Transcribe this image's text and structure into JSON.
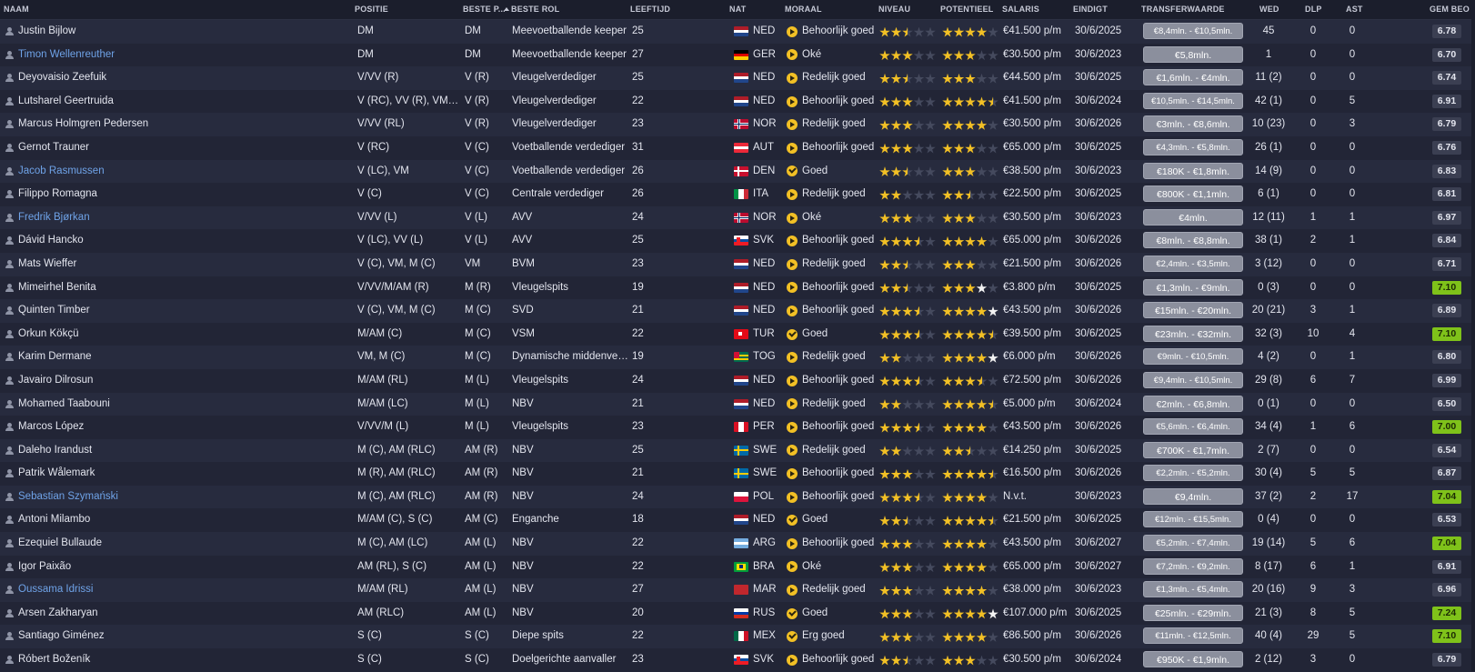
{
  "headers": {
    "naam": "NAAM",
    "positie": "POSITIE",
    "beste_p": "BESTE P...",
    "beste_rol": "BESTE ROL",
    "leeftijd": "LEEFTIJD",
    "nat": "NAT",
    "moraal": "MORAAL",
    "niveau": "NIVEAU",
    "potentieel": "POTENTIEEL",
    "salaris": "SALARIS",
    "eindigt": "EINDIGT",
    "transferwaarde": "TRANSFERWAARDE",
    "wed": "WED",
    "dlp": "DLP",
    "ast": "AST",
    "gem_beo": "GEM BEO"
  },
  "colors": {
    "link": "#6fa3e8",
    "star": "#f2c025",
    "rating_good": "#7fc21a"
  },
  "players": [
    {
      "name": "Justin Bijlow",
      "link": false,
      "pos": "DM",
      "bp": "DM",
      "rol": "Meevoetballende keeper",
      "age": "25",
      "nat": "NED",
      "flag": "ned",
      "moral": "Behoorlijk goed",
      "mi": "arrow",
      "niv": "ffhee",
      "pot": "ffffe",
      "sal": "€41.500 p/m",
      "end": "30/6/2025",
      "tv": "€8,4mln. - €10,5mln.",
      "wed": "45",
      "dlp": "0",
      "ast": "0",
      "gb": "6.78"
    },
    {
      "name": "Timon Wellenreuther",
      "link": true,
      "pos": "DM",
      "bp": "DM",
      "rol": "Meevoetballende keeper",
      "age": "27",
      "nat": "GER",
      "flag": "ger",
      "moral": "Oké",
      "mi": "arrow",
      "niv": "fffee",
      "pot": "fffee",
      "sal": "€30.500 p/m",
      "end": "30/6/2023",
      "tv": "€5,8mln.",
      "wed": "1",
      "dlp": "0",
      "ast": "0",
      "gb": "6.70"
    },
    {
      "name": "Deyovaisio Zeefuik",
      "link": false,
      "pos": "V/VV (R)",
      "bp": "V (R)",
      "rol": "Vleugelverdediger",
      "age": "25",
      "nat": "NED",
      "flag": "ned",
      "moral": "Redelijk goed",
      "mi": "arrow",
      "niv": "ffhee",
      "pot": "fffee",
      "sal": "€44.500 p/m",
      "end": "30/6/2025",
      "tv": "€1,6mln. - €4mln.",
      "wed": "11 (2)",
      "dlp": "0",
      "ast": "0",
      "gb": "6.74"
    },
    {
      "name": "Lutsharel Geertruida",
      "link": false,
      "pos": "V (RC), VV (R), VM, M...",
      "bp": "V (R)",
      "rol": "Vleugelverdediger",
      "age": "22",
      "nat": "NED",
      "flag": "ned",
      "moral": "Behoorlijk goed",
      "mi": "arrow",
      "niv": "fffee",
      "pot": "ffffh",
      "sal": "€41.500 p/m",
      "end": "30/6/2024",
      "tv": "€10,5mln. - €14,5mln.",
      "wed": "42 (1)",
      "dlp": "0",
      "ast": "5",
      "gb": "6.91"
    },
    {
      "name": "Marcus Holmgren Pedersen",
      "link": false,
      "pos": "V/VV (RL)",
      "bp": "V (R)",
      "rol": "Vleugelverdediger",
      "age": "23",
      "nat": "NOR",
      "flag": "nor",
      "moral": "Redelijk goed",
      "mi": "arrow",
      "niv": "fffee",
      "pot": "ffffe",
      "sal": "€30.500 p/m",
      "end": "30/6/2026",
      "tv": "€3mln. - €8,6mln.",
      "wed": "10 (23)",
      "dlp": "0",
      "ast": "3",
      "gb": "6.79"
    },
    {
      "name": "Gernot Trauner",
      "link": false,
      "pos": "V (RC)",
      "bp": "V (C)",
      "rol": "Voetballende verdediger",
      "age": "31",
      "nat": "AUT",
      "flag": "aut",
      "moral": "Behoorlijk goed",
      "mi": "arrow",
      "niv": "fffee",
      "pot": "fffee",
      "sal": "€65.000 p/m",
      "end": "30/6/2025",
      "tv": "€4,3mln. - €5,8mln.",
      "wed": "26 (1)",
      "dlp": "0",
      "ast": "0",
      "gb": "6.76"
    },
    {
      "name": "Jacob Rasmussen",
      "link": true,
      "pos": "V (LC), VM",
      "bp": "V (C)",
      "rol": "Voetballende verdediger",
      "age": "26",
      "nat": "DEN",
      "flag": "den",
      "moral": "Goed",
      "mi": "check",
      "niv": "ffhee",
      "pot": "fffee",
      "sal": "€38.500 p/m",
      "end": "30/6/2023",
      "tv": "€180K - €1,8mln.",
      "wed": "14 (9)",
      "dlp": "0",
      "ast": "0",
      "gb": "6.83"
    },
    {
      "name": "Filippo Romagna",
      "link": false,
      "pos": "V (C)",
      "bp": "V (C)",
      "rol": "Centrale verdediger",
      "age": "26",
      "nat": "ITA",
      "flag": "ita",
      "moral": "Redelijk goed",
      "mi": "arrow",
      "niv": "ffeee",
      "pot": "ffhee",
      "sal": "€22.500 p/m",
      "end": "30/6/2025",
      "tv": "€800K - €1,1mln.",
      "wed": "6 (1)",
      "dlp": "0",
      "ast": "0",
      "gb": "6.81"
    },
    {
      "name": "Fredrik Bjørkan",
      "link": true,
      "pos": "V/VV (L)",
      "bp": "V (L)",
      "rol": "AVV",
      "age": "24",
      "nat": "NOR",
      "flag": "nor",
      "moral": "Oké",
      "mi": "arrow",
      "niv": "fffee",
      "pot": "fffee",
      "sal": "€30.500 p/m",
      "end": "30/6/2023",
      "tv": "€4mln.",
      "wed": "12 (11)",
      "dlp": "1",
      "ast": "1",
      "gb": "6.97"
    },
    {
      "name": "Dávid Hancko",
      "link": false,
      "pos": "V (LC), VV (L)",
      "bp": "V (L)",
      "rol": "AVV",
      "age": "25",
      "nat": "SVK",
      "flag": "svk",
      "moral": "Behoorlijk goed",
      "mi": "arrow",
      "niv": "fffhe",
      "pot": "ffffe",
      "sal": "€65.000 p/m",
      "end": "30/6/2026",
      "tv": "€8mln. - €8,8mln.",
      "wed": "38 (1)",
      "dlp": "2",
      "ast": "1",
      "gb": "6.84"
    },
    {
      "name": "Mats Wieffer",
      "link": false,
      "pos": "V (C), VM, M (C)",
      "bp": "VM",
      "rol": "BVM",
      "age": "23",
      "nat": "NED",
      "flag": "ned",
      "moral": "Redelijk goed",
      "mi": "arrow",
      "niv": "ffhee",
      "pot": "fffee",
      "sal": "€21.500 p/m",
      "end": "30/6/2026",
      "tv": "€2,4mln. - €3,5mln.",
      "wed": "3 (12)",
      "dlp": "0",
      "ast": "0",
      "gb": "6.71"
    },
    {
      "name": "Mimeirhel Benita",
      "link": false,
      "pos": "V/VV/M/AM (R)",
      "bp": "M (R)",
      "rol": "Vleugelspits",
      "age": "19",
      "nat": "NED",
      "flag": "ned",
      "moral": "Behoorlijk goed",
      "mi": "arrow",
      "niv": "ffhee",
      "pot": "fffwe",
      "sal": "€3.800 p/m",
      "end": "30/6/2025",
      "tv": "€1,3mln. - €9mln.",
      "wed": "0 (3)",
      "dlp": "0",
      "ast": "0",
      "gb": "7.10"
    },
    {
      "name": "Quinten Timber",
      "link": false,
      "pos": "V (C), VM, M (C)",
      "bp": "M (C)",
      "rol": "SVD",
      "age": "21",
      "nat": "NED",
      "flag": "ned",
      "moral": "Behoorlijk goed",
      "mi": "arrow",
      "niv": "fffhe",
      "pot": "ffffw",
      "sal": "€43.500 p/m",
      "end": "30/6/2026",
      "tv": "€15mln. - €20mln.",
      "wed": "20 (21)",
      "dlp": "3",
      "ast": "1",
      "gb": "6.89"
    },
    {
      "name": "Orkun Kökçü",
      "link": false,
      "pos": "M/AM (C)",
      "bp": "M (C)",
      "rol": "VSM",
      "age": "22",
      "nat": "TUR",
      "flag": "tur",
      "moral": "Goed",
      "mi": "check",
      "niv": "fffhe",
      "pot": "ffffh",
      "sal": "€39.500 p/m",
      "end": "30/6/2025",
      "tv": "€23mln. - €32mln.",
      "wed": "32 (3)",
      "dlp": "10",
      "ast": "4",
      "gb": "7.10"
    },
    {
      "name": "Karim Dermane",
      "link": false,
      "pos": "VM, M (C)",
      "bp": "M (C)",
      "rol": "Dynamische middenvelder",
      "age": "19",
      "nat": "TOG",
      "flag": "tog",
      "moral": "Redelijk goed",
      "mi": "arrow",
      "niv": "ffeee",
      "pot": "ffffw",
      "sal": "€6.000 p/m",
      "end": "30/6/2026",
      "tv": "€9mln. - €10,5mln.",
      "wed": "4 (2)",
      "dlp": "0",
      "ast": "1",
      "gb": "6.80"
    },
    {
      "name": "Javairo Dilrosun",
      "link": false,
      "pos": "M/AM (RL)",
      "bp": "M (L)",
      "rol": "Vleugelspits",
      "age": "24",
      "nat": "NED",
      "flag": "ned",
      "moral": "Behoorlijk goed",
      "mi": "arrow",
      "niv": "fffhe",
      "pot": "fffhe",
      "sal": "€72.500 p/m",
      "end": "30/6/2026",
      "tv": "€9,4mln. - €10,5mln.",
      "wed": "29 (8)",
      "dlp": "6",
      "ast": "7",
      "gb": "6.99"
    },
    {
      "name": "Mohamed Taabouni",
      "link": false,
      "pos": "M/AM (LC)",
      "bp": "M (L)",
      "rol": "NBV",
      "age": "21",
      "nat": "NED",
      "flag": "ned",
      "moral": "Redelijk goed",
      "mi": "arrow",
      "niv": "ffeee",
      "pot": "ffffh",
      "sal": "€5.000 p/m",
      "end": "30/6/2024",
      "tv": "€2mln. - €6,8mln.",
      "wed": "0 (1)",
      "dlp": "0",
      "ast": "0",
      "gb": "6.50"
    },
    {
      "name": "Marcos López",
      "link": false,
      "pos": "V/VV/M (L)",
      "bp": "M (L)",
      "rol": "Vleugelspits",
      "age": "23",
      "nat": "PER",
      "flag": "per",
      "moral": "Behoorlijk goed",
      "mi": "arrow",
      "niv": "fffhe",
      "pot": "ffffe",
      "sal": "€43.500 p/m",
      "end": "30/6/2026",
      "tv": "€5,6mln. - €6,4mln.",
      "wed": "34 (4)",
      "dlp": "1",
      "ast": "6",
      "gb": "7.00"
    },
    {
      "name": "Daleho Irandust",
      "link": false,
      "pos": "M (C), AM (RLC)",
      "bp": "AM (R)",
      "rol": "NBV",
      "age": "25",
      "nat": "SWE",
      "flag": "swe",
      "moral": "Redelijk goed",
      "mi": "arrow",
      "niv": "ffeee",
      "pot": "ffhee",
      "sal": "€14.250 p/m",
      "end": "30/6/2025",
      "tv": "€700K - €1,7mln.",
      "wed": "2 (7)",
      "dlp": "0",
      "ast": "0",
      "gb": "6.54"
    },
    {
      "name": "Patrik Wålemark",
      "link": false,
      "pos": "M (R), AM (RLC)",
      "bp": "AM (R)",
      "rol": "NBV",
      "age": "21",
      "nat": "SWE",
      "flag": "swe",
      "moral": "Behoorlijk goed",
      "mi": "arrow",
      "niv": "fffee",
      "pot": "ffffh",
      "sal": "€16.500 p/m",
      "end": "30/6/2026",
      "tv": "€2,2mln. - €5,2mln.",
      "wed": "30 (4)",
      "dlp": "5",
      "ast": "5",
      "gb": "6.87"
    },
    {
      "name": "Sebastian Szymański",
      "link": true,
      "pos": "M (C), AM (RLC)",
      "bp": "AM (R)",
      "rol": "NBV",
      "age": "24",
      "nat": "POL",
      "flag": "pol",
      "moral": "Behoorlijk goed",
      "mi": "arrow",
      "niv": "fffhe",
      "pot": "ffffe",
      "sal": "N.v.t.",
      "end": "30/6/2023",
      "tv": "€9,4mln.",
      "wed": "37 (2)",
      "dlp": "2",
      "ast": "17",
      "gb": "7.04"
    },
    {
      "name": "Antoni Milambo",
      "link": false,
      "pos": "M/AM (C), S (C)",
      "bp": "AM (C)",
      "rol": "Enganche",
      "age": "18",
      "nat": "NED",
      "flag": "ned",
      "moral": "Goed",
      "mi": "check",
      "niv": "ffhee",
      "pot": "ffffh",
      "sal": "€21.500 p/m",
      "end": "30/6/2025",
      "tv": "€12mln. - €15,5mln.",
      "wed": "0 (4)",
      "dlp": "0",
      "ast": "0",
      "gb": "6.53"
    },
    {
      "name": "Ezequiel Bullaude",
      "link": false,
      "pos": "M (C), AM (LC)",
      "bp": "AM (L)",
      "rol": "NBV",
      "age": "22",
      "nat": "ARG",
      "flag": "arg",
      "moral": "Behoorlijk goed",
      "mi": "arrow",
      "niv": "fffee",
      "pot": "ffffe",
      "sal": "€43.500 p/m",
      "end": "30/6/2027",
      "tv": "€5,2mln. - €7,4mln.",
      "wed": "19 (14)",
      "dlp": "5",
      "ast": "6",
      "gb": "7.04"
    },
    {
      "name": "Igor Paixão",
      "link": false,
      "pos": "AM (RL), S (C)",
      "bp": "AM (L)",
      "rol": "NBV",
      "age": "22",
      "nat": "BRA",
      "flag": "bra",
      "moral": "Oké",
      "mi": "arrow",
      "niv": "fffee",
      "pot": "ffffe",
      "sal": "€65.000 p/m",
      "end": "30/6/2027",
      "tv": "€7,2mln. - €9,2mln.",
      "wed": "8 (17)",
      "dlp": "6",
      "ast": "1",
      "gb": "6.91"
    },
    {
      "name": "Oussama Idrissi",
      "link": true,
      "pos": "M/AM (RL)",
      "bp": "AM (L)",
      "rol": "NBV",
      "age": "27",
      "nat": "MAR",
      "flag": "mar",
      "moral": "Redelijk goed",
      "mi": "arrow",
      "niv": "fffee",
      "pot": "ffffe",
      "sal": "€38.000 p/m",
      "end": "30/6/2023",
      "tv": "€1,3mln. - €5,4mln.",
      "wed": "20 (16)",
      "dlp": "9",
      "ast": "3",
      "gb": "6.96"
    },
    {
      "name": "Arsen Zakharyan",
      "link": false,
      "pos": "AM (RLC)",
      "bp": "AM (L)",
      "rol": "NBV",
      "age": "20",
      "nat": "RUS",
      "flag": "rus",
      "moral": "Goed",
      "mi": "check",
      "niv": "fffee",
      "pot": "ffffw",
      "sal": "€107.000 p/m",
      "end": "30/6/2025",
      "tv": "€25mln. - €29mln.",
      "wed": "21 (3)",
      "dlp": "8",
      "ast": "5",
      "gb": "7.24"
    },
    {
      "name": "Santiago Giménez",
      "link": false,
      "pos": "S (C)",
      "bp": "S (C)",
      "rol": "Diepe spits",
      "age": "22",
      "nat": "MEX",
      "flag": "mex",
      "moral": "Erg goed",
      "mi": "check",
      "niv": "fffee",
      "pot": "ffffe",
      "sal": "€86.500 p/m",
      "end": "30/6/2026",
      "tv": "€11mln. - €12,5mln.",
      "wed": "40 (4)",
      "dlp": "29",
      "ast": "5",
      "gb": "7.10"
    },
    {
      "name": "Róbert Boženík",
      "link": false,
      "pos": "S (C)",
      "bp": "S (C)",
      "rol": "Doelgerichte aanvaller",
      "age": "23",
      "nat": "SVK",
      "flag": "svk",
      "moral": "Behoorlijk goed",
      "mi": "arrow",
      "niv": "ffhee",
      "pot": "fffee",
      "sal": "€30.500 p/m",
      "end": "30/6/2024",
      "tv": "€950K - €1,9mln.",
      "wed": "2 (12)",
      "dlp": "3",
      "ast": "0",
      "gb": "6.79"
    }
  ]
}
